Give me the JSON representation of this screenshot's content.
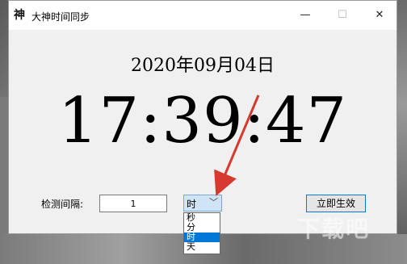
{
  "window": {
    "title": "大神时间同步",
    "icon_glyph": "神",
    "controls": {
      "minimize": "—",
      "maximize": "☐",
      "close": "✕"
    }
  },
  "clock": {
    "date": "2020年09月04日",
    "time": "17:39:47"
  },
  "form": {
    "interval_label": "检测间隔:",
    "interval_value": "1",
    "unit_selected": "时",
    "unit_options": [
      "秒",
      "分",
      "时",
      "天"
    ],
    "unit_selected_index": 2,
    "apply_button": "立即生效"
  },
  "colors": {
    "annotation_arrow": "#d63a2e",
    "selection_highlight": "#0078d7"
  },
  "watermark": "下载吧"
}
